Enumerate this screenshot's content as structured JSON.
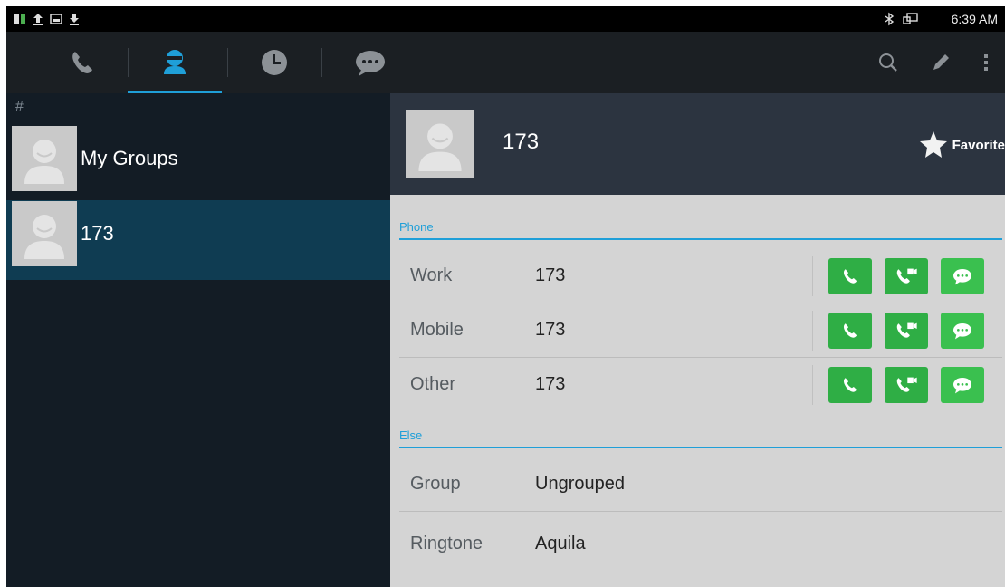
{
  "status_bar": {
    "icons": [
      "network-usage-icon",
      "upload-icon",
      "screenshot-icon",
      "download-icon"
    ],
    "right_icons": [
      "bluetooth-icon",
      "screen-mirror-icon"
    ],
    "time": "6:39 AM"
  },
  "tabs": [
    {
      "name": "phone-icon",
      "active": false
    },
    {
      "name": "contacts-icon",
      "active": true
    },
    {
      "name": "history-icon",
      "active": false
    },
    {
      "name": "messages-icon",
      "active": false
    }
  ],
  "toolbar": {
    "icons": [
      "search-icon",
      "edit-icon",
      "more-icon"
    ]
  },
  "contact_list": {
    "section_label": "#",
    "items": [
      {
        "name": "My Groups"
      },
      {
        "name": "173",
        "selected": true
      }
    ]
  },
  "detail": {
    "name": "173",
    "favorite_label": "Favorite",
    "phone_section": "Phone",
    "phones": [
      {
        "label": "Work",
        "value": "173"
      },
      {
        "label": "Mobile",
        "value": "173"
      },
      {
        "label": "Other",
        "value": "173"
      }
    ],
    "else_section": "Else",
    "else_rows": [
      {
        "label": "Group",
        "value": "Ungrouped"
      },
      {
        "label": "Ringtone",
        "value": "Aquila"
      }
    ]
  },
  "colors": {
    "accent": "#1f9fd8",
    "action_green": "#2fae45",
    "selected_row": "#0f3c52",
    "header_bg": "#2c3440"
  }
}
